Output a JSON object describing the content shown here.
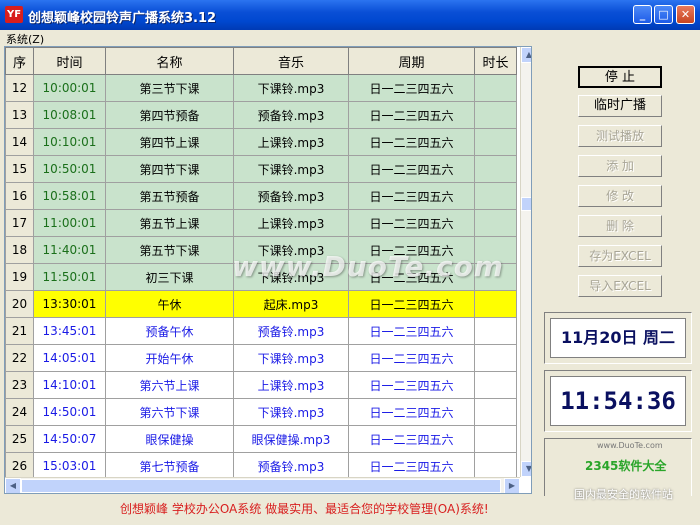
{
  "window": {
    "icon_text": "YF",
    "title": "创想颖峰校园铃声广播系统3.12",
    "minimize": "_",
    "maximize": "□",
    "close": "✕"
  },
  "menu": {
    "system": "系统(Z)"
  },
  "grid": {
    "headers": [
      "序",
      "时间",
      "名称",
      "音乐",
      "周期",
      "时长"
    ],
    "rows": [
      {
        "idx": "12",
        "time": "10:00:01",
        "name": "第三节下课",
        "music": "下课铃.mp3",
        "cycle": "日一二三四五六",
        "duration": "",
        "state": "past"
      },
      {
        "idx": "13",
        "time": "10:08:01",
        "name": "第四节预备",
        "music": "预备铃.mp3",
        "cycle": "日一二三四五六",
        "duration": "",
        "state": "past"
      },
      {
        "idx": "14",
        "time": "10:10:01",
        "name": "第四节上课",
        "music": "上课铃.mp3",
        "cycle": "日一二三四五六",
        "duration": "",
        "state": "past"
      },
      {
        "idx": "15",
        "time": "10:50:01",
        "name": "第四节下课",
        "music": "下课铃.mp3",
        "cycle": "日一二三四五六",
        "duration": "",
        "state": "past"
      },
      {
        "idx": "16",
        "time": "10:58:01",
        "name": "第五节预备",
        "music": "预备铃.mp3",
        "cycle": "日一二三四五六",
        "duration": "",
        "state": "past"
      },
      {
        "idx": "17",
        "time": "11:00:01",
        "name": "第五节上课",
        "music": "上课铃.mp3",
        "cycle": "日一二三四五六",
        "duration": "",
        "state": "past"
      },
      {
        "idx": "18",
        "time": "11:40:01",
        "name": "第五节下课",
        "music": "下课铃.mp3",
        "cycle": "日一二三四五六",
        "duration": "",
        "state": "past"
      },
      {
        "idx": "19",
        "time": "11:50:01",
        "name": "初三下课",
        "music": "下课铃.mp3",
        "cycle": "日一二三四五六",
        "duration": "",
        "state": "past"
      },
      {
        "idx": "20",
        "time": "13:30:01",
        "name": "午休",
        "music": "起床.mp3",
        "cycle": "日一二三四五六",
        "duration": "",
        "state": "current"
      },
      {
        "idx": "21",
        "time": "13:45:01",
        "name": "预备午休",
        "music": "预备铃.mp3",
        "cycle": "日一二三四五六",
        "duration": "",
        "state": "future"
      },
      {
        "idx": "22",
        "time": "14:05:01",
        "name": "开始午休",
        "music": "下课铃.mp3",
        "cycle": "日一二三四五六",
        "duration": "",
        "state": "future"
      },
      {
        "idx": "23",
        "time": "14:10:01",
        "name": "第六节上课",
        "music": "上课铃.mp3",
        "cycle": "日一二三四五六",
        "duration": "",
        "state": "future"
      },
      {
        "idx": "24",
        "time": "14:50:01",
        "name": "第六节下课",
        "music": "下课铃.mp3",
        "cycle": "日一二三四五六",
        "duration": "",
        "state": "future"
      },
      {
        "idx": "25",
        "time": "14:50:07",
        "name": "眼保健操",
        "music": "眼保健操.mp3",
        "cycle": "日一二三四五六",
        "duration": "",
        "state": "future"
      },
      {
        "idx": "26",
        "time": "15:03:01",
        "name": "第七节预备",
        "music": "预备铃.mp3",
        "cycle": "日一二三四五六",
        "duration": "",
        "state": "future"
      }
    ]
  },
  "buttons": {
    "stop": "停 止",
    "temp_broadcast": "临时广播",
    "test_play": "测试播放",
    "add": "添 加",
    "edit": "修 改",
    "delete": "删 除",
    "export_excel": "存为EXCEL",
    "import_excel": "导入EXCEL"
  },
  "date_display": "11月20日 周二",
  "clock_display": "11:54:36",
  "logo": {
    "text": "2345软件大全",
    "sub": "www.DuoTe.com"
  },
  "status": {
    "text": "创想颖峰  学校办公OA系统  做最实用、最适合您的学校管理(OA)系统!",
    "right_mark": "国内最安全的软件站"
  },
  "watermarks": {
    "center": "www.DuoTe.com",
    "corner": "www.DuoTe.com"
  },
  "colors": {
    "past_row": "#c9e3cc",
    "current_row": "#ffff00",
    "future_text": "#1a1ae6",
    "status_text": "#d81e1e"
  }
}
